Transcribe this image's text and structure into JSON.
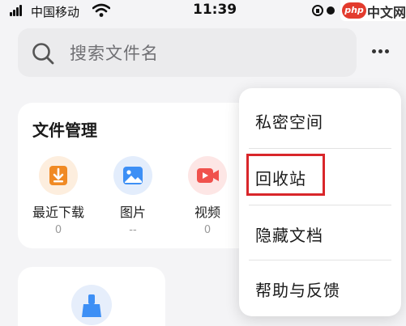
{
  "status_bar": {
    "carrier": "中国移动",
    "time": "11:39",
    "watermark_badge": "php",
    "watermark_text": "中文网"
  },
  "search": {
    "placeholder": "搜索文件名",
    "icon": "search-icon"
  },
  "more_menu_icon": "more-horizontal-icon",
  "file_management": {
    "title": "文件管理",
    "tiles": [
      {
        "label": "最近下载",
        "count": "0",
        "icon": "download-icon",
        "color": "#f08a24"
      },
      {
        "label": "图片",
        "count": "--",
        "icon": "image-icon",
        "color": "#3d8ff5"
      },
      {
        "label": "视频",
        "count": "0",
        "icon": "video-icon",
        "color": "#f0524d"
      }
    ]
  },
  "second_card": {
    "icon": "broom-clean-icon"
  },
  "menu": {
    "items": [
      {
        "label": "私密空间"
      },
      {
        "label": "回收站"
      },
      {
        "label": "隐藏文档"
      },
      {
        "label": "帮助与反馈"
      }
    ],
    "highlighted_item": "回收站",
    "highlight_color": "#d9262a"
  }
}
